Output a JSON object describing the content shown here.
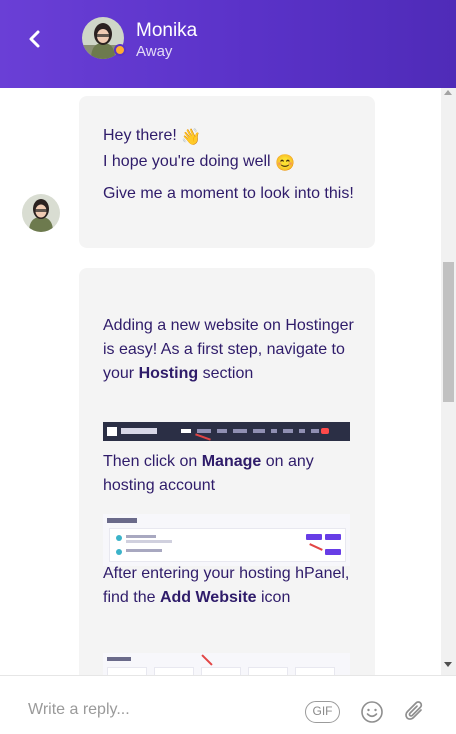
{
  "header": {
    "agent_name": "Monika",
    "agent_status": "Away",
    "status_color": "#ffad33",
    "gradient": [
      "#6a3fd6",
      "#4f2bb8"
    ]
  },
  "messages": [
    {
      "sender": "Monika",
      "lines": {
        "greeting": "Hey there!",
        "greeting_emoji": "👋",
        "wellbeing": "I hope you're doing well",
        "wellbeing_emoji": "😊",
        "wait": "Give me a moment to look into this!"
      }
    },
    {
      "sender": "Monika",
      "parts": {
        "p1_text": "Adding a new website on Hostinger is easy! As a first step, navigate to your ",
        "p1_bold": "Hosting",
        "p1_end": " section",
        "p2_text": "Then click on ",
        "p2_bold": "Manage",
        "p2_end": " on any hosting account",
        "p3_text": "After entering your hosting hPanel, find the ",
        "p3_bold": "Add Website",
        "p3_end": " icon"
      },
      "screenshots": [
        "hostinger-navbar-screenshot",
        "hosting-list-screenshot",
        "domains-tiles-screenshot"
      ]
    }
  ],
  "composer": {
    "placeholder": "Write a reply...",
    "gif_label": "GIF",
    "icons": [
      "gif-icon",
      "emoji-icon",
      "attachment-icon"
    ]
  }
}
